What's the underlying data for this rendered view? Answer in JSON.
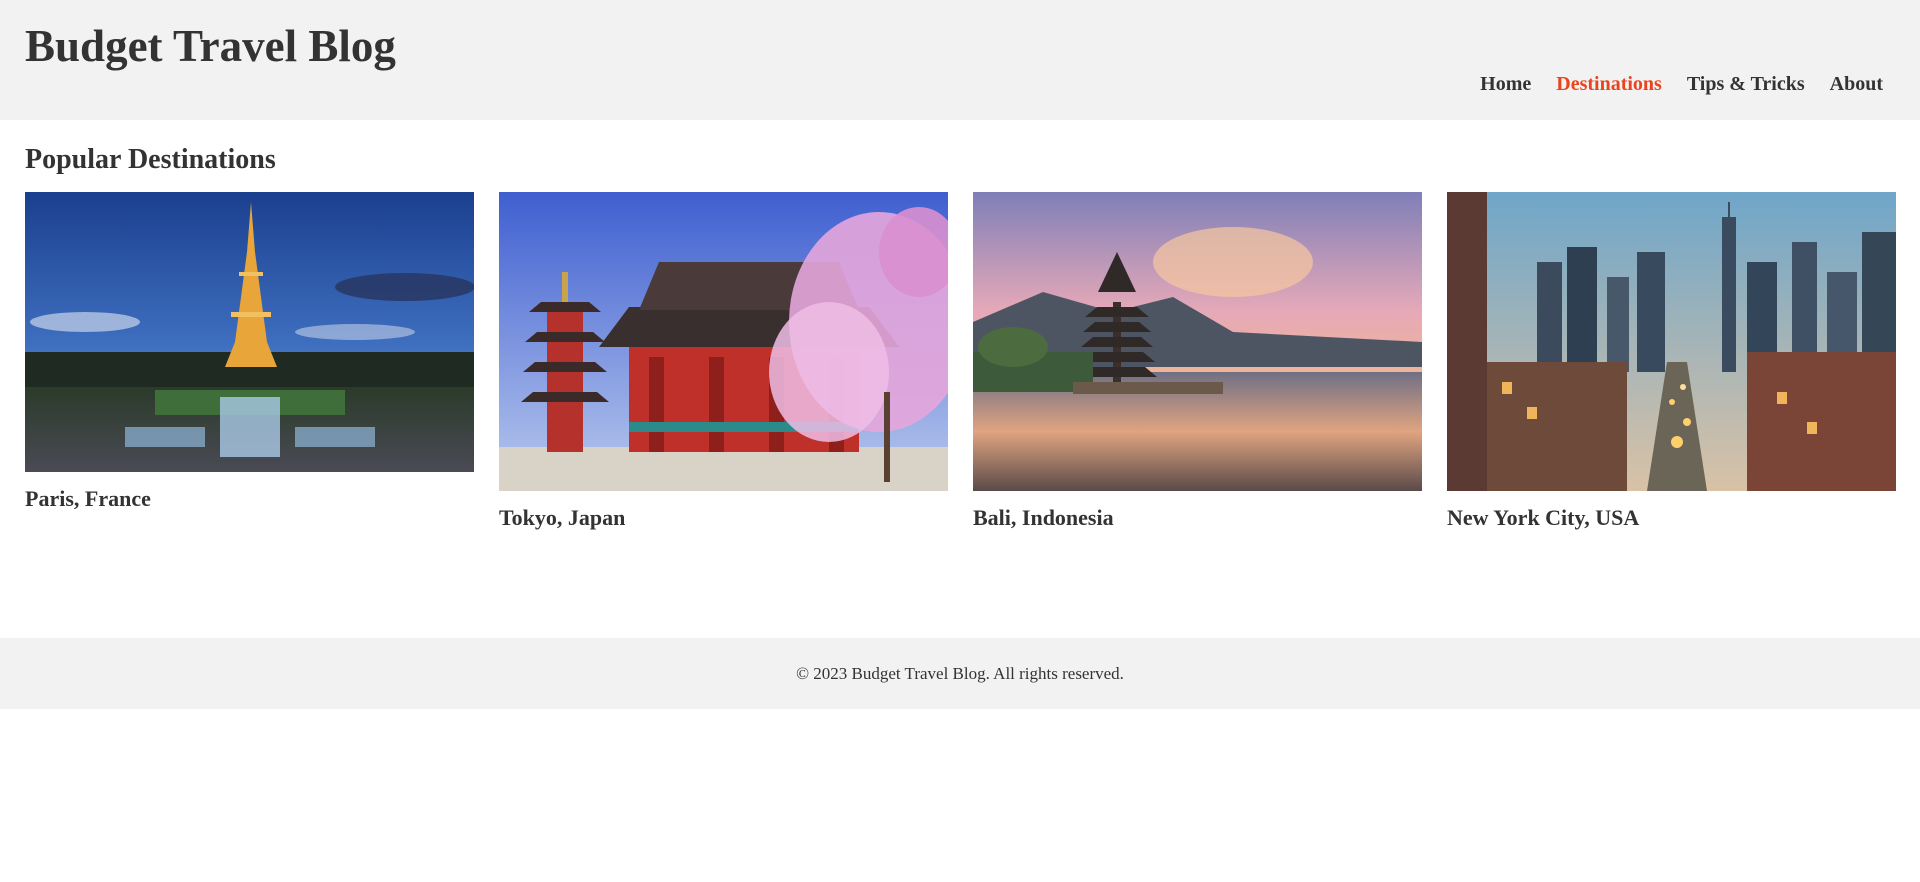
{
  "site": {
    "title": "Budget Travel Blog"
  },
  "nav": {
    "items": [
      {
        "label": "Home",
        "active": false
      },
      {
        "label": "Destinations",
        "active": true
      },
      {
        "label": "Tips & Tricks",
        "active": false
      },
      {
        "label": "About",
        "active": false
      }
    ]
  },
  "main": {
    "section_title": "Popular Destinations",
    "destinations": [
      {
        "name": "Paris, France",
        "image": "eiffel-tower-night-photo"
      },
      {
        "name": "Tokyo, Japan",
        "image": "pagoda-cherry-blossom-photo"
      },
      {
        "name": "Bali, Indonesia",
        "image": "lake-temple-sunset-photo"
      },
      {
        "name": "New York City, USA",
        "image": "city-street-dusk-photo"
      }
    ]
  },
  "footer": {
    "text": "© 2023 Budget Travel Blog. All rights reserved."
  },
  "colors": {
    "header_bg": "#f2f2f2",
    "accent": "#e8451e",
    "text": "#333333"
  }
}
